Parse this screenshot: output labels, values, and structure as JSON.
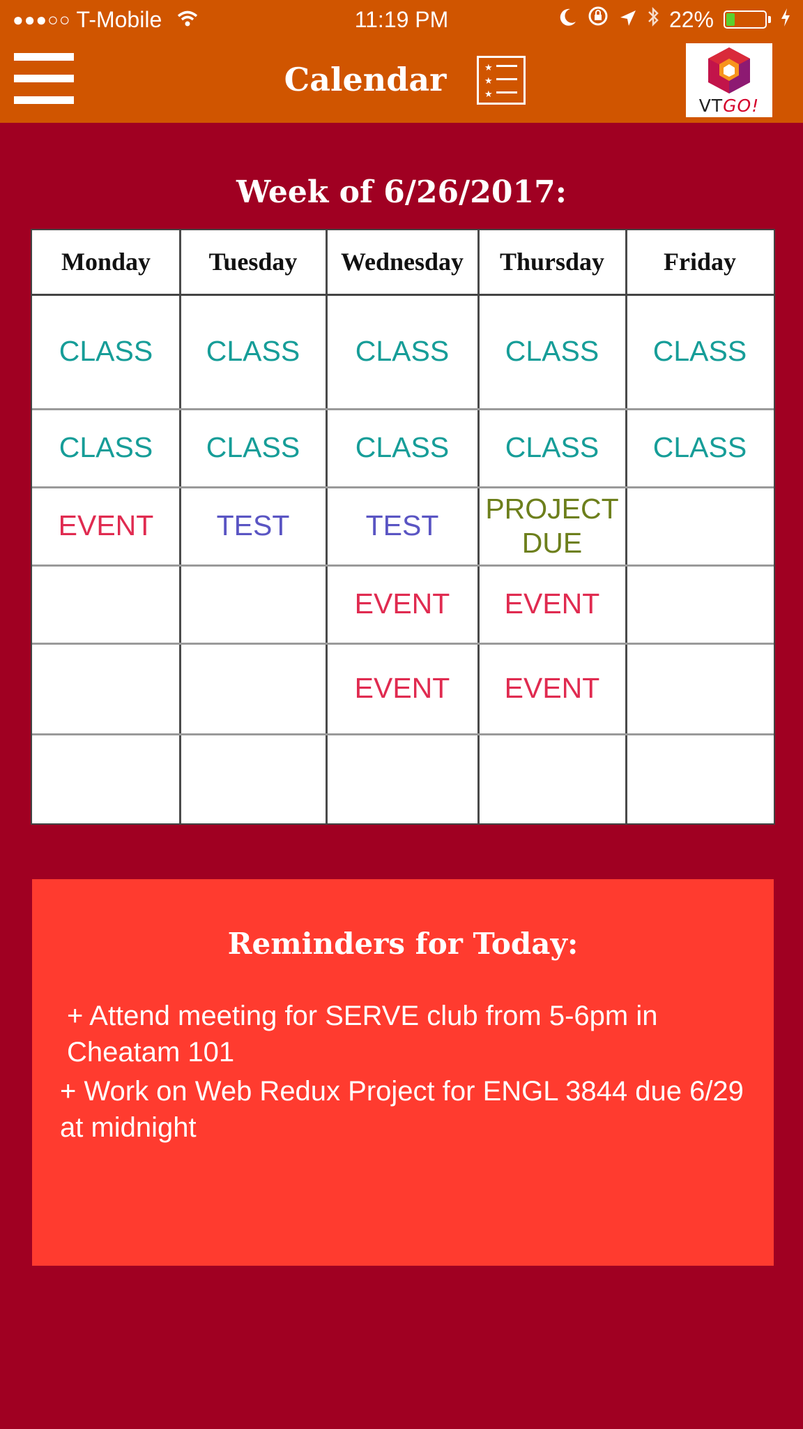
{
  "status_bar": {
    "signal": "●●●○○",
    "carrier": "T-Mobile",
    "time": "11:19 PM",
    "battery": "22%",
    "battery_level": 0.22
  },
  "navbar": {
    "title": "Calendar",
    "logo_text_a": "VT",
    "logo_text_b": "GO!"
  },
  "week_title": "Week of 6/26/2017:",
  "calendar": {
    "days": [
      "Monday",
      "Tuesday",
      "Wednesday",
      "Thursday",
      "Friday"
    ],
    "rows": [
      [
        "CLASS",
        "CLASS",
        "CLASS",
        "CLASS",
        "CLASS"
      ],
      [
        "CLASS",
        "CLASS",
        "CLASS",
        "CLASS",
        "CLASS"
      ],
      [
        "EVENT",
        "TEST",
        "TEST",
        "PROJECT DUE",
        ""
      ],
      [
        "",
        "",
        "EVENT",
        "EVENT",
        ""
      ],
      [
        "",
        "",
        "EVENT",
        "EVENT",
        ""
      ],
      [
        "",
        "",
        "",
        "",
        ""
      ]
    ]
  },
  "reminders": {
    "title": "Reminders for Today:",
    "items": [
      "+ Attend meeting for SERVE club from 5-6pm in Cheatam 101",
      "+ Work on Web Redux Project for ENGL 3844 due 6/29 at midnight"
    ]
  },
  "colors": {
    "header": "#d05500",
    "background": "#a00022",
    "reminders_bg": "#ff3b2f",
    "class": "#169d98",
    "event": "#e02b50",
    "test": "#5a55c3",
    "project": "#6d7f1c"
  }
}
